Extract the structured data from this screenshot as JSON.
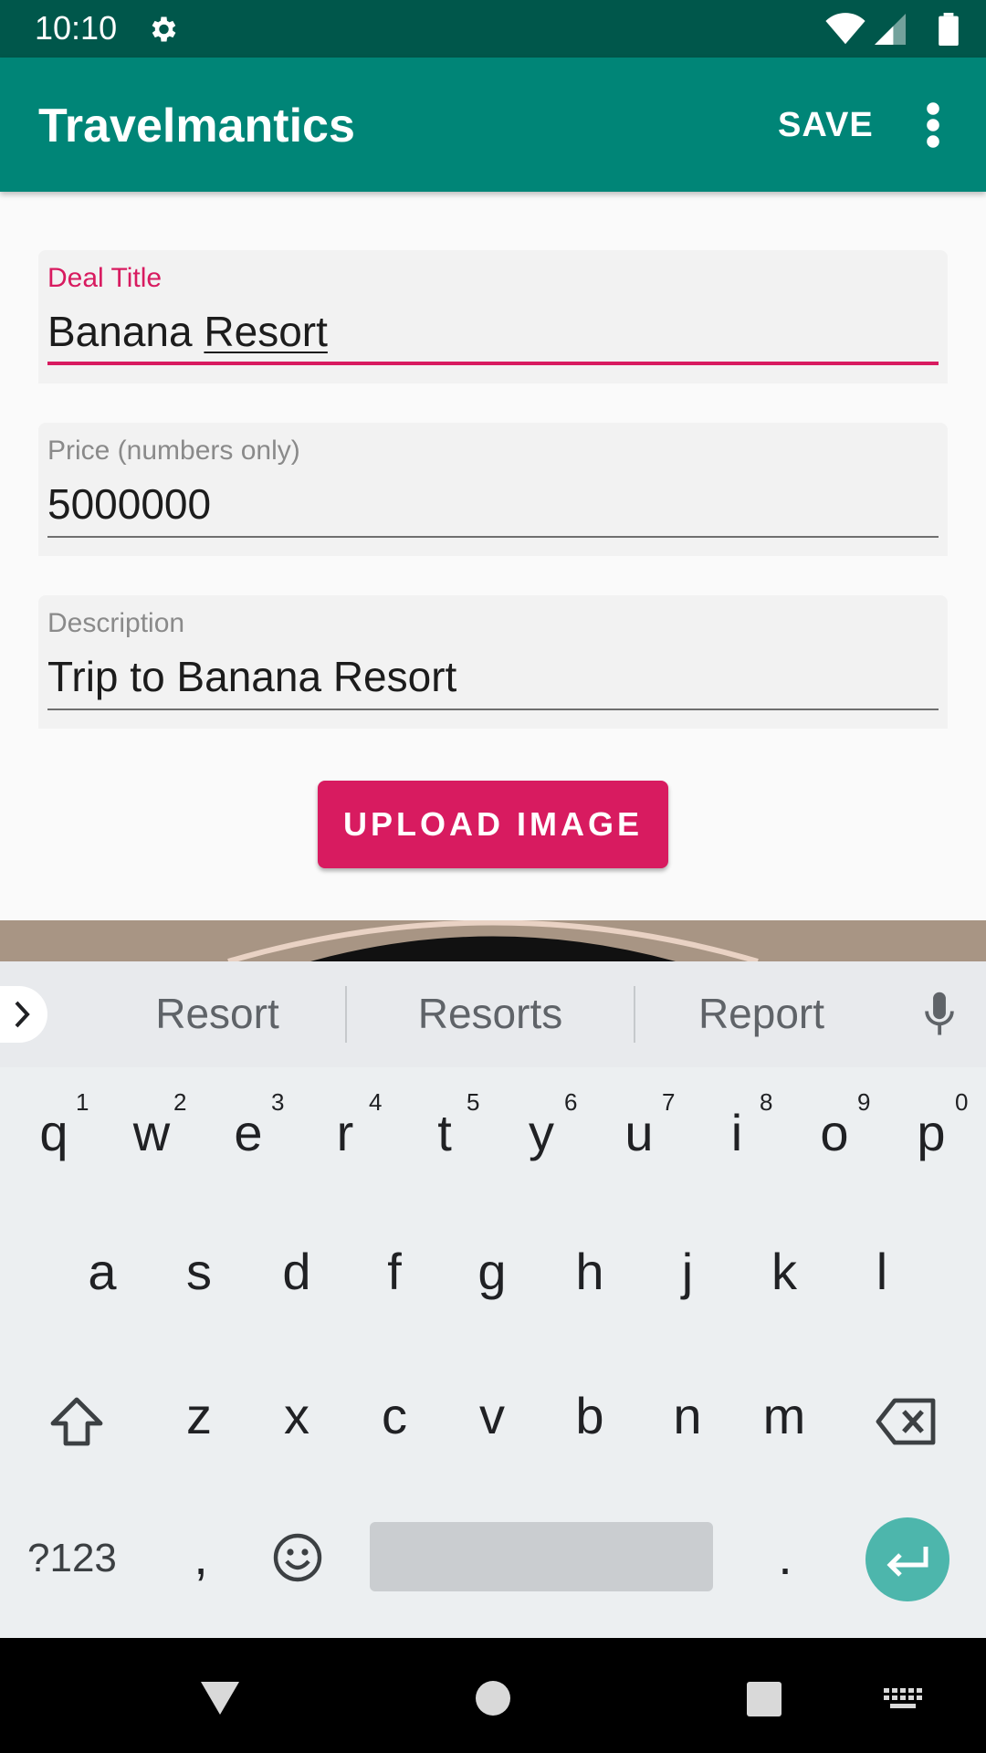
{
  "status": {
    "time": "10:10"
  },
  "appbar": {
    "title": "Travelmantics",
    "save_label": "SAVE"
  },
  "form": {
    "title_label": "Deal Title",
    "title_value_plain": "Banana ",
    "title_value_underlined": "Resort",
    "price_label": "Price (numbers only)",
    "price_value": "5000000",
    "description_label": "Description",
    "description_value": "Trip to Banana Resort",
    "upload_label": "UPLOAD IMAGE"
  },
  "keyboard": {
    "suggestions": [
      "Resort",
      "Resorts",
      "Report"
    ],
    "row1": [
      "q",
      "w",
      "e",
      "r",
      "t",
      "y",
      "u",
      "i",
      "o",
      "p"
    ],
    "row1_numbers": [
      "1",
      "2",
      "3",
      "4",
      "5",
      "6",
      "7",
      "8",
      "9",
      "0"
    ],
    "row2": [
      "a",
      "s",
      "d",
      "f",
      "g",
      "h",
      "j",
      "k",
      "l"
    ],
    "row3": [
      "z",
      "x",
      "c",
      "v",
      "b",
      "n",
      "m"
    ],
    "symbols_label": "?123",
    "comma": ",",
    "period": "."
  },
  "colors": {
    "primary": "#008577",
    "primary_dark": "#00574b",
    "accent": "#d81b60",
    "enter_key": "#4db6ac"
  }
}
